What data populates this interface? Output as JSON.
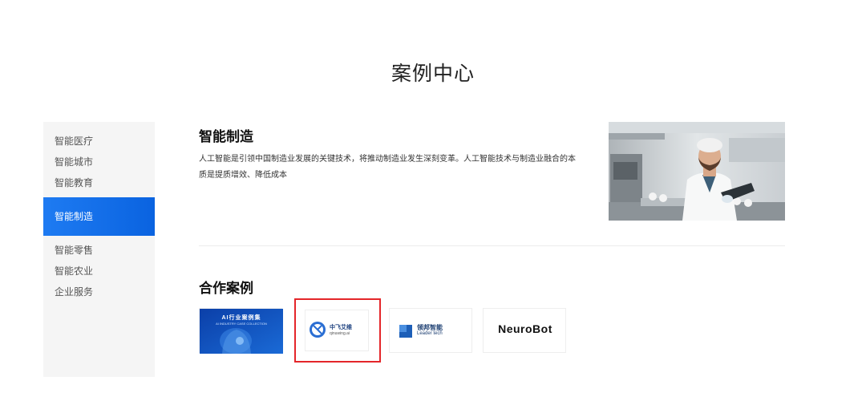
{
  "page": {
    "title": "案例中心"
  },
  "sidebar": {
    "items": [
      {
        "label": "智能医疗",
        "active": false
      },
      {
        "label": "智能城市",
        "active": false
      },
      {
        "label": "智能教育",
        "active": false
      },
      {
        "label": "智能制造",
        "active": true
      },
      {
        "label": "智能零售",
        "active": false
      },
      {
        "label": "智能农业",
        "active": false
      },
      {
        "label": "企业服务",
        "active": false
      }
    ]
  },
  "main": {
    "heading": "智能制造",
    "description": "人工智能是引领中国制造业发展的关键技术，将推动制造业发生深刻变革。人工智能技术与制造业融合的本质是提质增效、降低成本",
    "partners_heading": "合作案例",
    "partners": [
      {
        "title": "AI行业案例集",
        "subtitle": "AI INDUSTRY CASE COLLECTION",
        "icon": "robot-head-icon"
      },
      {
        "title": "中飞艾维",
        "subtitle": "qinuwing.ai",
        "icon": "circle-logo-icon"
      },
      {
        "title": "领邦智能",
        "subtitle": "Leader tech",
        "icon": "leader-logo-icon"
      },
      {
        "title": "NeuroBot",
        "subtitle": "",
        "icon": "neurobot-logo-icon"
      }
    ]
  },
  "colors": {
    "accent": "#0a63e0",
    "selected_border": "#e4262a"
  }
}
